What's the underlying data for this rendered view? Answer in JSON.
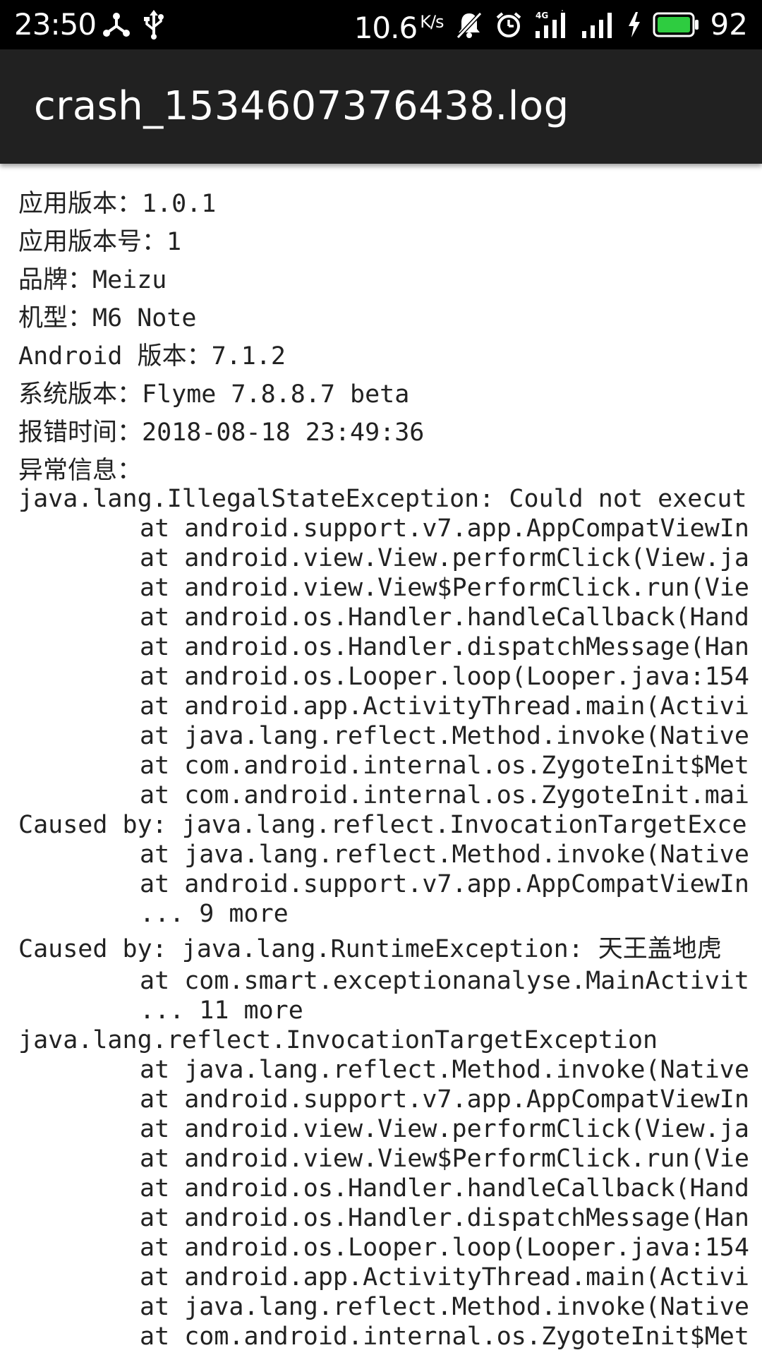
{
  "status_bar": {
    "time": "23:50",
    "speed_value": "10.6",
    "speed_unit": "K/s",
    "battery_percent": "92",
    "icons": [
      "network-share-icon",
      "usb-icon",
      "bell-muted-icon",
      "alarm-icon",
      "signal-4g-icon",
      "signal-icon",
      "charging-icon",
      "battery-icon"
    ],
    "battery_color": "#2ecc40"
  },
  "app_bar": {
    "title": "crash_1534607376438.log",
    "background": "#212121"
  },
  "info": {
    "lines": [
      "应用版本：1.0.1",
      "应用版本号：1",
      "品牌：Meizu",
      "机型：M6 Note",
      "Android 版本：7.1.2",
      "系统版本：Flyme 7.8.8.7 beta",
      "报错时间：2018-08-18 23:49:36",
      "异常信息："
    ]
  },
  "stack_trace": {
    "lines": [
      "java.lang.IllegalStateException: Could not execut",
      "at android.support.v7.app.AppCompatViewIn",
      "at android.view.View.performClick(View.ja",
      "at android.view.View$PerformClick.run(Vie",
      "at android.os.Handler.handleCallback(Hand",
      "at android.os.Handler.dispatchMessage(Han",
      "at android.os.Looper.loop(Looper.java:154",
      "at android.app.ActivityThread.main(Activi",
      "at java.lang.reflect.Method.invoke(Native",
      "at com.android.internal.os.ZygoteInit$Met",
      "at com.android.internal.os.ZygoteInit.mai",
      "Caused by: java.lang.reflect.InvocationTargetExce",
      "at java.lang.reflect.Method.invoke(Native",
      "at android.support.v7.app.AppCompatViewIn",
      "... 9 more",
      "Caused by: java.lang.RuntimeException: 天王盖地虎",
      "at com.smart.exceptionanalyse.MainActivit",
      "... 11 more",
      "java.lang.reflect.InvocationTargetException",
      "at java.lang.reflect.Method.invoke(Native",
      "at android.support.v7.app.AppCompatViewIn",
      "at android.view.View.performClick(View.ja",
      "at android.view.View$PerformClick.run(Vie",
      "at android.os.Handler.handleCallback(Hand",
      "at android.os.Handler.dispatchMessage(Han",
      "at android.os.Looper.loop(Looper.java:154",
      "at android.app.ActivityThread.main(Activi",
      "at java.lang.reflect.Method.invoke(Native",
      "at com.android.internal.os.ZygoteInit$Met"
    ]
  }
}
